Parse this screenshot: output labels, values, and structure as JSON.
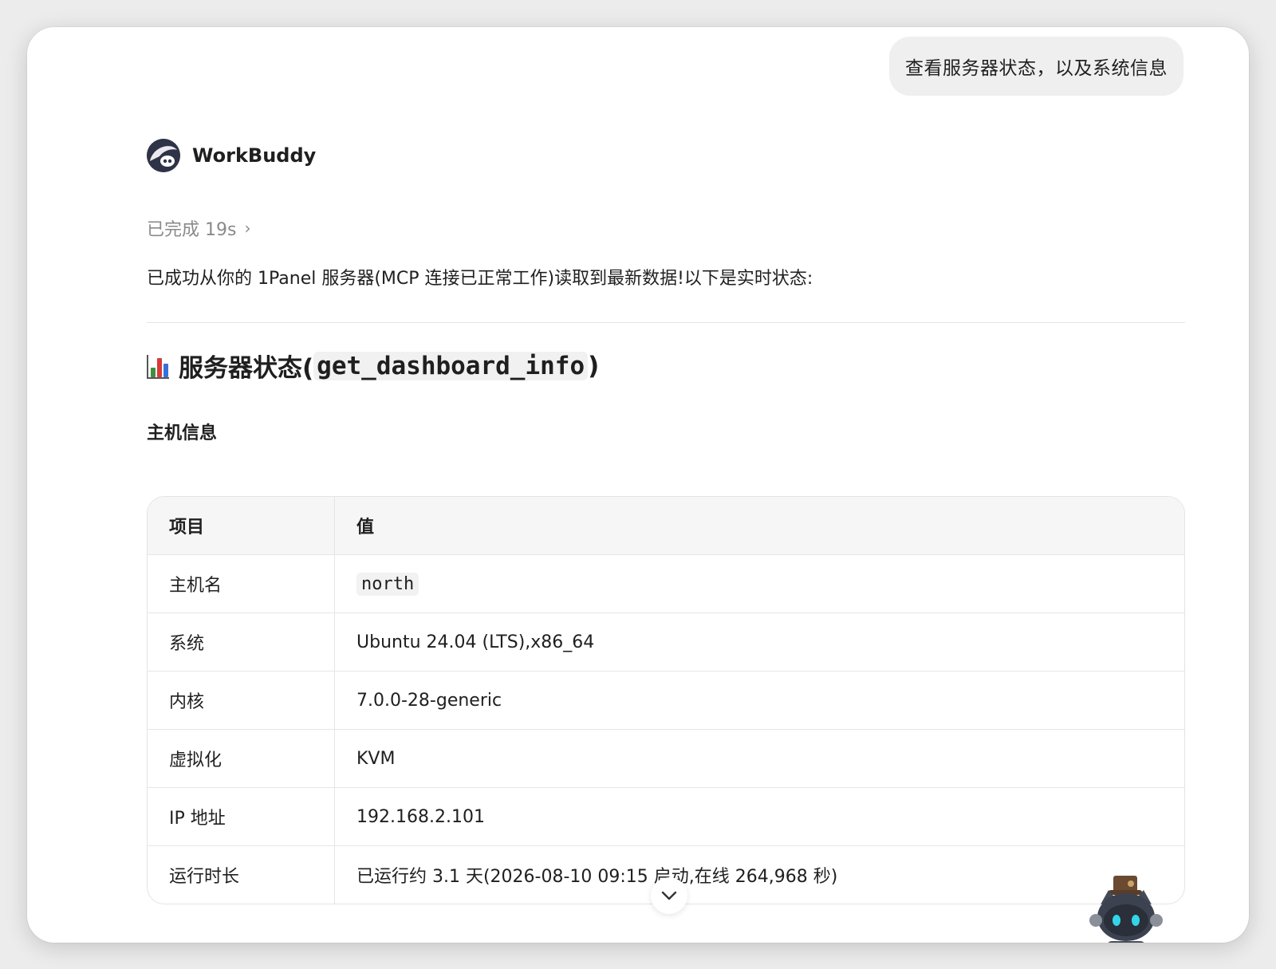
{
  "user_message": "查看服务器状态，以及系统信息",
  "agent": {
    "name": "WorkBuddy",
    "status": "已完成 19s"
  },
  "response": {
    "intro": "已成功从你的 1Panel 服务器(MCP 连接已正常工作)读取到最新数据!以下是实时状态:",
    "section_title_prefix": "服务器状态(",
    "section_title_code": "get_dashboard_info",
    "section_title_suffix": ")",
    "subsection_title": "主机信息",
    "table": {
      "headers": [
        "项目",
        "值"
      ],
      "rows": [
        {
          "label": "主机名",
          "value": "north"
        },
        {
          "label": "系统",
          "value": "Ubuntu 24.04 (LTS),x86_64"
        },
        {
          "label": "内核",
          "value": "7.0.0-28-generic"
        },
        {
          "label": "虚拟化",
          "value": "KVM"
        },
        {
          "label": "IP 地址",
          "value": "192.168.2.101"
        },
        {
          "label": "运行时长",
          "value": "已运行约 3.1 天(2026-08-10 09:15 启动,在线 264,968 秒)"
        }
      ]
    }
  },
  "icons": {
    "section": "bar-chart-icon",
    "status_expand": "chevron-right-icon",
    "scroll": "chevron-down-icon"
  },
  "colors": {
    "bubble_bg": "#efefef",
    "muted_text": "#8a8a8a",
    "avatar_bg": "#2f3347"
  }
}
